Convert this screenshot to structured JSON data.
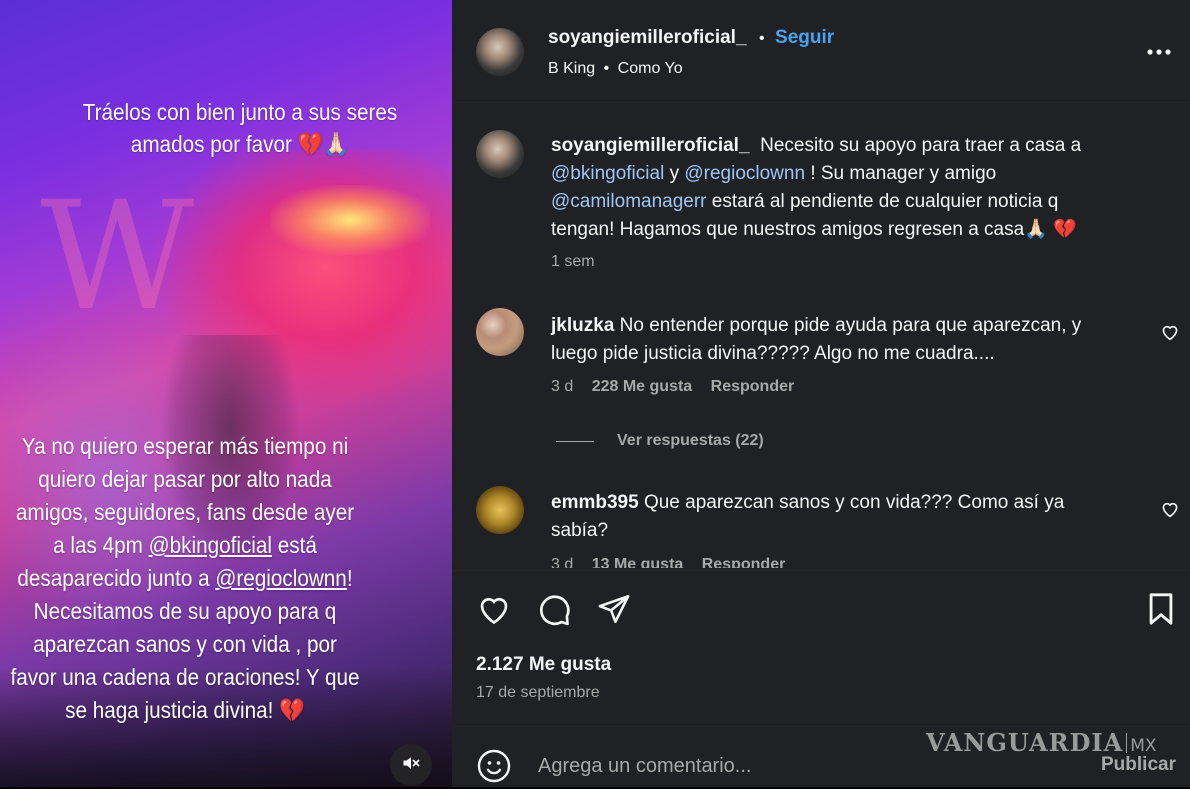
{
  "story": {
    "text1_line1": "Tráelos con bien junto a sus seres",
    "text1_line2": "amados por favor 💔🙏🏻",
    "text2": {
      "l1": "Ya no quiero esperar más tiempo ni",
      "l2": "quiero dejar pasar por alto nada",
      "l3": "amigos, seguidores, fans desde ayer",
      "l4_pre": "a las 4pm ",
      "l4_mention": "@bkingoficial",
      "l4_post": " está",
      "l5_pre": "desaparecido junto a ",
      "l5_mention": "@regioclownn",
      "l5_post": "!",
      "l6": "Necesitamos de su apoyo para q",
      "l7": "aparezcan sanos y con vida , por",
      "l8": "favor una cadena de oraciones! Y que",
      "l9": "se haga justicia divina! 💔"
    }
  },
  "header": {
    "username": "soyangiemilleroficial_",
    "dot": "•",
    "follow": "Seguir",
    "audio_artist": "B King",
    "audio_sep": "•",
    "audio_song": "Como Yo"
  },
  "caption": {
    "username": "soyangiemilleroficial_",
    "t1": "Necesito su apoyo para traer a casa a",
    "m1": "@bkingoficial",
    "t2": " y ",
    "m2": "@regioclownn",
    "t3": " ! Su manager y amigo",
    "m3": "@camilomanagerr",
    "t4": " estará al pendiente de cualquier noticia q",
    "t5": "tengan! Hagamos que nuestros amigos regresen a casa🙏🏻 💔",
    "time": "1 sem"
  },
  "comments": [
    {
      "username": "jkluzka",
      "text1": "No entender porque pide ayuda para que aparezcan, y",
      "text2": "luego pide justicia divina????? Algo no me cuadra....",
      "time": "3 d",
      "likes": "228 Me gusta",
      "reply": "Responder",
      "view_replies": "Ver respuestas (22)"
    },
    {
      "username": "emmb395",
      "text1": "Que aparezcan sanos y con vida??? Como así ya",
      "text2": "sabía?",
      "time": "3 d",
      "likes": "13 Me gusta",
      "reply": "Responder"
    }
  ],
  "stats": {
    "likes": "2.127 Me gusta",
    "date": "17 de septiembre"
  },
  "comment_box": {
    "placeholder": "Agrega un comentario...",
    "publish": "Publicar"
  },
  "watermark": {
    "name": "VANGUARDIA",
    "suffix": "MX"
  },
  "colors": {
    "panel_bg": "#202124",
    "link": "#9ec6f5",
    "follow": "#4aa3f0"
  }
}
